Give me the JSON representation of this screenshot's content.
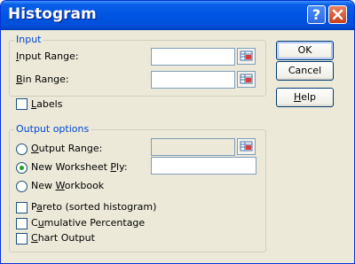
{
  "window": {
    "title": "Histogram"
  },
  "input_group": {
    "title": "Input",
    "input_range_label": {
      "pre": "",
      "u": "I",
      "post": "nput Range:"
    },
    "input_range_value": "",
    "bin_range_label": {
      "pre": "",
      "u": "B",
      "post": "in Range:"
    },
    "bin_range_value": ""
  },
  "labels_checkbox": {
    "pre": "",
    "u": "L",
    "post": "abels",
    "checked": false
  },
  "output_group": {
    "title": "Output options",
    "output_range": {
      "pre": "",
      "u": "O",
      "post": "utput Range:",
      "selected": false,
      "value": ""
    },
    "new_worksheet_ply": {
      "pre": "New Worksheet ",
      "u": "P",
      "post": "ly:",
      "selected": true,
      "value": ""
    },
    "new_workbook": {
      "pre": "New ",
      "u": "W",
      "post": "orkbook",
      "selected": false
    },
    "pareto": {
      "pre": "P",
      "u": "a",
      "post": "reto (sorted histogram)",
      "checked": false
    },
    "cumulative": {
      "pre": "C",
      "u": "u",
      "post": "mulative Percentage",
      "checked": false
    },
    "chart_output": {
      "pre": "",
      "u": "C",
      "post": "hart Output",
      "checked": false
    }
  },
  "buttons": {
    "ok": "OK",
    "cancel": "Cancel",
    "help": {
      "pre": "",
      "u": "H",
      "post": "elp"
    }
  },
  "icons": {
    "help": "help-question-icon",
    "close": "close-x-icon",
    "range_ref": "range-reference-icon"
  },
  "colors": {
    "titlebar": "#0054e3",
    "dialog_bg": "#ece9d8",
    "group_title": "#0046d5",
    "close_button": "#c93d1a"
  }
}
